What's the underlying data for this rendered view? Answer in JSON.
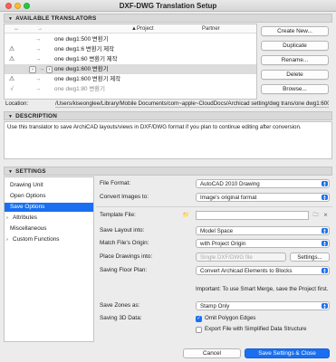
{
  "window": {
    "title": "DXF-DWG Translation Setup",
    "traffic_colors": [
      "#fd5f57",
      "#febc2e",
      "#28c840"
    ]
  },
  "translators": {
    "header": "AVAILABLE TRANSLATORS",
    "columns": {
      "c1": "↔",
      "c2": "→",
      "project": "▲Project",
      "partner": "Partner"
    },
    "rows": [
      {
        "c1": "",
        "c2": "→",
        "name": "one dwg1:500 변환기",
        "selected": false
      },
      {
        "c1": "⚠",
        "c2": "→",
        "name": "one dwg1:6 변환기 제작",
        "selected": false
      },
      {
        "c1": "⚠",
        "c2": "→",
        "name": "one dwg1:60 변환기 제작",
        "selected": false
      },
      {
        "c1": "",
        "c2": "→",
        "name": "one dwg1:600 변환기",
        "selected": true
      },
      {
        "c1": "⚠",
        "c2": "→",
        "name": "one dwg1:600 변환기 제작",
        "selected": false
      },
      {
        "c1": "√",
        "c2": "→",
        "name": "one dwg1:80 변환기",
        "selected": false
      }
    ],
    "buttons": {
      "create": "Create New...",
      "duplicate": "Duplicate",
      "rename": "Rename...",
      "delete": "Delete",
      "browse": "Browse..."
    },
    "location_label": "Location:",
    "location_value": "/Users/kiseonglee/Library/Mobile Documents/com~apple~CloudDocs/Archicad setting/dwg trans/one dwg1:600"
  },
  "description": {
    "header": "DESCRIPTION",
    "text": "Use this translator to save ArchiCAD layouts/views in DXF/DWG format if you plan to continue editing after conversion."
  },
  "settings": {
    "header": "SETTINGS",
    "nav": [
      {
        "label": "Drawing Unit",
        "chevron": "",
        "active": false
      },
      {
        "label": "Open Options",
        "chevron": "",
        "active": false
      },
      {
        "label": "Save Options",
        "chevron": "",
        "active": true
      },
      {
        "label": "Attributes",
        "chevron": "›",
        "active": false
      },
      {
        "label": "Miscellaneous",
        "chevron": "",
        "active": false
      },
      {
        "label": "Custom Functions",
        "chevron": "›",
        "active": false
      }
    ],
    "file_format_label": "File Format:",
    "file_format_value": "AutoCAD 2010 Drawing",
    "convert_images_label": "Convert Images to:",
    "convert_images_value": "Image's original format",
    "template_file_label": "Template File:",
    "template_file_value": "",
    "save_layout_label": "Save Layout into:",
    "save_layout_value": "Model Space",
    "match_origin_label": "Match File's Origin:",
    "match_origin_value": "with Project Origin",
    "place_drawings_label": "Place Drawings into:",
    "place_drawings_value": "Single DXF/DWG file",
    "place_drawings_settings": "Settings...",
    "saving_floor_plan_label": "Saving Floor Plan:",
    "saving_floor_plan_value": "Convert Archicad Elements to Blocks",
    "floor_plan_note": "Important: To use Smart Merge, save the Project first.",
    "save_zones_label": "Save Zones as:",
    "save_zones_value": "Stamp Only",
    "saving_3d_label": "Saving 3D Data:",
    "omit_polygon_edges": "Omit Polygon Edges",
    "omit_polygon_edges_checked": true,
    "export_simplified": "Export File with Simplified Data Structure",
    "export_simplified_checked": false
  },
  "footer": {
    "cancel": "Cancel",
    "save_close": "Save Settings & Close"
  },
  "colors": {
    "accent": "#1a6ff0",
    "arrow_green": "#28a745",
    "arrow_blue": "#3a73d8"
  }
}
